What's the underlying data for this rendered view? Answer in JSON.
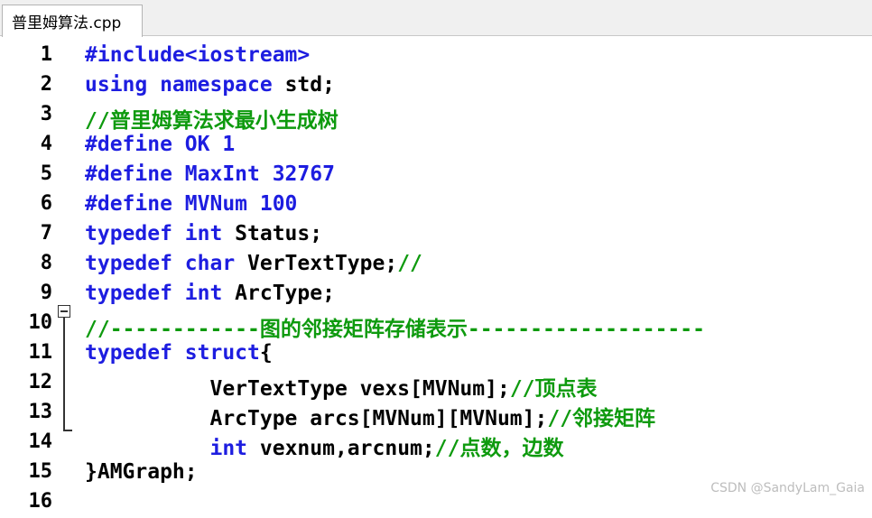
{
  "tab": {
    "title": "普里姆算法.cpp"
  },
  "colors": {
    "keyword": "#1d1de0",
    "identifier": "#000000",
    "comment": "#0e9a0e"
  },
  "lines": [
    {
      "no": "1",
      "tokens": [
        {
          "t": "#include<iostream>",
          "c": "kw"
        }
      ]
    },
    {
      "no": "2",
      "tokens": [
        {
          "t": "using namespace ",
          "c": "kw"
        },
        {
          "t": "std;",
          "c": "id"
        }
      ]
    },
    {
      "no": "3",
      "tokens": [
        {
          "t": "//普里姆算法求最小生成树",
          "c": "cm"
        }
      ]
    },
    {
      "no": "4",
      "tokens": [
        {
          "t": "#define OK 1",
          "c": "kw"
        }
      ]
    },
    {
      "no": "5",
      "tokens": [
        {
          "t": "#define MaxInt 32767",
          "c": "kw"
        }
      ]
    },
    {
      "no": "6",
      "tokens": [
        {
          "t": "#define MVNum 100",
          "c": "kw"
        }
      ]
    },
    {
      "no": "7",
      "tokens": [
        {
          "t": "typedef int ",
          "c": "kw"
        },
        {
          "t": "Status;",
          "c": "id"
        }
      ]
    },
    {
      "no": "8",
      "tokens": [
        {
          "t": "typedef char ",
          "c": "kw"
        },
        {
          "t": "VerTextType;",
          "c": "id"
        },
        {
          "t": "//",
          "c": "cm"
        }
      ]
    },
    {
      "no": "9",
      "tokens": [
        {
          "t": "typedef int ",
          "c": "kw"
        },
        {
          "t": "ArcType;",
          "c": "id"
        }
      ]
    },
    {
      "no": "10",
      "tokens": [
        {
          "t": "//------------图的邻接矩阵存储表示-------------------",
          "c": "cm"
        }
      ]
    },
    {
      "no": "11",
      "tokens": [
        {
          "t": "typedef struct",
          "c": "kw"
        },
        {
          "t": "{",
          "c": "id"
        }
      ]
    },
    {
      "no": "12",
      "tokens": [
        {
          "t": "          VerTextType vexs[MVNum];",
          "c": "id"
        },
        {
          "t": "//顶点表",
          "c": "cm"
        }
      ]
    },
    {
      "no": "13",
      "tokens": [
        {
          "t": "          ArcType arcs[MVNum][MVNum];",
          "c": "id"
        },
        {
          "t": "//邻接矩阵",
          "c": "cm"
        }
      ]
    },
    {
      "no": "14",
      "tokens": [
        {
          "t": "          ",
          "c": "id"
        },
        {
          "t": "int ",
          "c": "kw"
        },
        {
          "t": "vexnum,arcnum;",
          "c": "id"
        },
        {
          "t": "//点数，边数",
          "c": "cm"
        }
      ]
    },
    {
      "no": "15",
      "tokens": [
        {
          "t": "}AMGraph;",
          "c": "id"
        }
      ]
    },
    {
      "no": "16",
      "tokens": []
    }
  ],
  "watermark": "CSDN @SandyLam_Gaia"
}
